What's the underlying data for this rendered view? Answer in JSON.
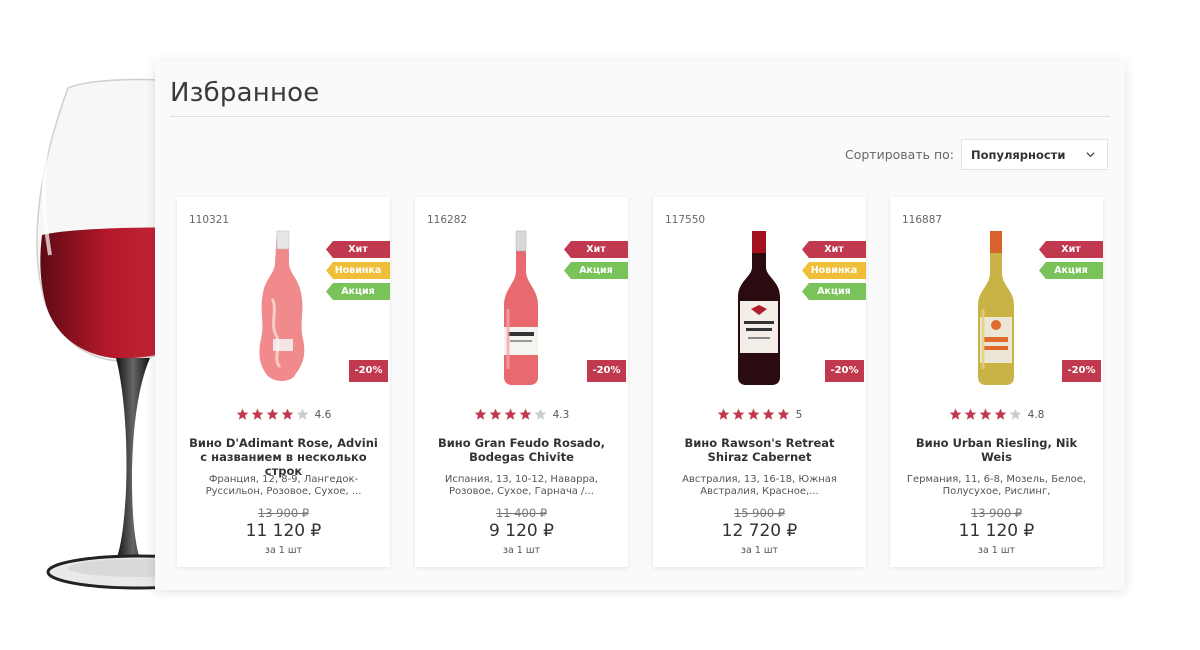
{
  "page": {
    "title": "Избранное",
    "sort_label": "Сортировать по:",
    "sort_value": "Популярности"
  },
  "colors": {
    "badge_hit": "#c0394f",
    "badge_new": "#efbf3a",
    "badge_sale": "#7ac25a",
    "discount": "#c0394f",
    "star_on": "#c0394f",
    "star_off": "#cccccc"
  },
  "products": [
    {
      "sku": "110321",
      "bottle": "rose-bottle",
      "badges": [
        "Хит",
        "Новинка",
        "Акция"
      ],
      "discount": "-20%",
      "stars": 4,
      "rating": "4.6",
      "name": "Вино D'Adimant Rose, Advini с названием в несколько строк",
      "desc": "Франция, 12, 8-9, Лангедок-Руссильон, Розовое, Сухое, ...",
      "old_price": "13 900 ₽",
      "price": "11 120 ₽",
      "unit": "за 1 шт"
    },
    {
      "sku": "116282",
      "bottle": "rose-bottle",
      "badges": [
        "Хит",
        "Акция"
      ],
      "discount": "-20%",
      "stars": 4,
      "rating": "4.3",
      "name": "Вино Gran Feudo Rosado, Bodegas Chivite",
      "desc": "Испания, 13, 10-12, Наварра, Розовое, Сухое, Гарнача /...",
      "old_price": "11 400 ₽",
      "price": "9 120 ₽",
      "unit": "за 1 шт"
    },
    {
      "sku": "117550",
      "bottle": "red-bottle",
      "badges": [
        "Хит",
        "Новинка",
        "Акция"
      ],
      "discount": "-20%",
      "stars": 5,
      "rating": "5",
      "name": "Вино Rawson's Retreat Shiraz Cabernet",
      "desc": "Австралия, 13, 16-18, Южная Австралия, Красное,...",
      "old_price": "15 900 ₽",
      "price": "12 720 ₽",
      "unit": "за 1 шт"
    },
    {
      "sku": "116887",
      "bottle": "white-bottle",
      "badges": [
        "Хит",
        "Акция"
      ],
      "discount": "-20%",
      "stars": 4,
      "rating": "4.8",
      "name": "Вино Urban Riesling, Nik Weis",
      "desc": "Германия, 11, 6-8, Мозель, Белое, Полусухое, Рислинг,",
      "old_price": "13 900 ₽",
      "price": "11 120 ₽",
      "unit": "за 1 шт"
    }
  ]
}
